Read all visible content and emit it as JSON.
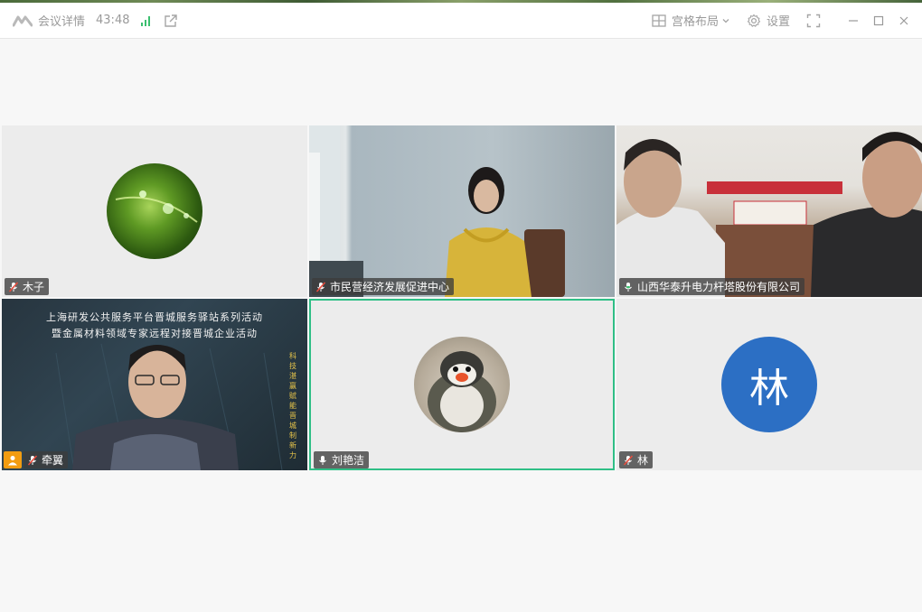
{
  "titlebar": {
    "meeting_details": "会议详情",
    "timer": "43:48",
    "layout_label": "宫格布局",
    "settings_label": "设置"
  },
  "tiles": [
    {
      "name": "木子",
      "mic": "muted",
      "kind": "avatar"
    },
    {
      "name": "市民营经济发展促进中心",
      "mic": "muted",
      "kind": "video"
    },
    {
      "name": "山西华泰升电力杆塔股份有限公司",
      "mic": "on",
      "kind": "video"
    },
    {
      "name": "牵翼",
      "mic": "muted",
      "kind": "video",
      "host": true
    },
    {
      "name": "刘艳洁",
      "mic": "on",
      "kind": "avatar",
      "active_speaker": true
    },
    {
      "name": "林",
      "mic": "muted",
      "kind": "letter",
      "letter": "林"
    }
  ],
  "banner": {
    "line1": "上海研发公共服务平台晋城服务驿站系列活动",
    "line2": "暨金属材料领域专家远程对接晋城企业活动",
    "vertical": "科技湛赢 赋能晋城制新力"
  },
  "colors": {
    "active_border": "#2fbf86",
    "letter_avatar_bg": "#2c6fc4",
    "host_badge": "#f29c11"
  }
}
